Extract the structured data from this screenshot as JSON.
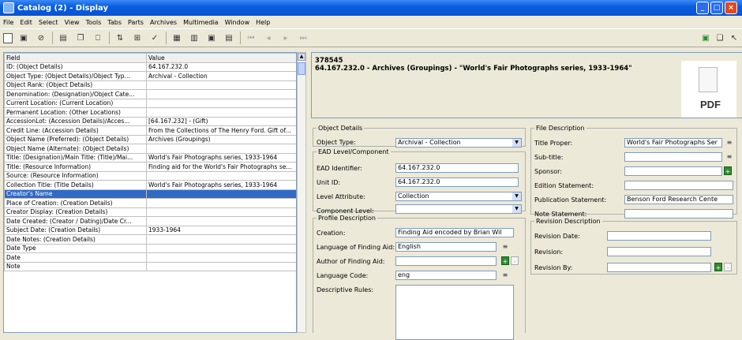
{
  "window": {
    "title": "Catalog (2) - Display"
  },
  "menu": [
    "File",
    "Edit",
    "Select",
    "View",
    "Tools",
    "Tabs",
    "Parts",
    "Archives",
    "Multimedia",
    "Window",
    "Help"
  ],
  "grid": {
    "headers": [
      "Field",
      "Value"
    ],
    "rows": [
      [
        "ID: (Object Details)",
        "64.167.232.0"
      ],
      [
        "Object Type: (Object Details)/Object Typ...",
        "Archival - Collection"
      ],
      [
        "Object Rank: (Object Details)",
        ""
      ],
      [
        "Denomination: (Designation)/Object Cate...",
        ""
      ],
      [
        "Current Location: (Current Location)",
        ""
      ],
      [
        "Permanent Location: (Other Locations)",
        ""
      ],
      [
        "AccessionLot: (Accession Details)/Acces...",
        "[64.167.232]  - (Gift)"
      ],
      [
        "Credit Line: (Accession Details)",
        "From the Collections of The Henry Ford.  Gift of..."
      ],
      [
        "Object Name (Preferred): (Object Details)",
        "Archives (Groupings)"
      ],
      [
        "Object Name (Alternate): (Object Details)",
        ""
      ],
      [
        "Title: (Designation)/Main Title: (Title)/Mai...",
        "World's Fair Photographs series, 1933-1964"
      ],
      [
        "Title: (Resource Information)",
        "Finding aid for the World's Fair Photographs se..."
      ],
      [
        "Source: (Resource Information)",
        ""
      ],
      [
        "Collection Title: (Title Details)",
        "World's Fair Photographs series, 1933-1964"
      ],
      [
        "Creator's Name",
        ""
      ],
      [
        "Place of Creation: (Creation Details)",
        ""
      ],
      [
        "Creator Display: (Creation Details)",
        ""
      ],
      [
        "Date Created: (Creator / Dating)/Date Cr...",
        ""
      ],
      [
        "Subject Date: (Creation Details)",
        "1933-1964"
      ],
      [
        "Date Notes: (Creation Details)",
        ""
      ],
      [
        "Date Type",
        ""
      ],
      [
        "Date",
        ""
      ],
      [
        "Note",
        ""
      ]
    ],
    "selected_row": 14
  },
  "record": {
    "id": "378545",
    "title": "64.167.232.0 - Archives (Groupings) - \"World's Fair Photographs series, 1933-1964\"",
    "pdf_label": "PDF"
  },
  "object_details": {
    "legend": "Object Details",
    "type_label": "Object Type:",
    "type_value": "Archival - Collection"
  },
  "ead": {
    "legend": "EAD Level/Component",
    "identifier_label": "EAD Identifier:",
    "identifier_value": "64.167.232.0",
    "unit_label": "Unit ID:",
    "unit_value": "64.167.232.0",
    "level_label": "Level Attribute:",
    "level_value": "Collection",
    "component_label": "Component Level:",
    "component_value": ""
  },
  "profile": {
    "legend": "Profile Description",
    "creation_label": "Creation:",
    "creation_value": "Finding Aid encoded by Brian Wil",
    "language_label": "Language of Finding Aid:",
    "language_value": "English",
    "author_label": "Author of Finding Aid:",
    "author_value": "",
    "code_label": "Language Code:",
    "code_value": "eng",
    "rules_label": "Descriptive Rules:"
  },
  "file_desc": {
    "legend": "File Description",
    "title_label": "Title Proper:",
    "title_value": "World's Fair Photographs Ser",
    "subtitle_label": "Sub-title:",
    "subtitle_value": "",
    "sponsor_label": "Sponsor:",
    "sponsor_value": "",
    "edition_label": "Edition Statement:",
    "edition_value": "",
    "publication_label": "Publication Statement:",
    "publication_value": "Benson Ford Research Cente",
    "note_label": "Note Statement:",
    "note_value": ""
  },
  "revision": {
    "legend": "Revision Description",
    "date_label": "Revision Date:",
    "date_value": "",
    "revision_label": "Revision:",
    "revision_value": "",
    "by_label": "Revision By:",
    "by_value": ""
  }
}
